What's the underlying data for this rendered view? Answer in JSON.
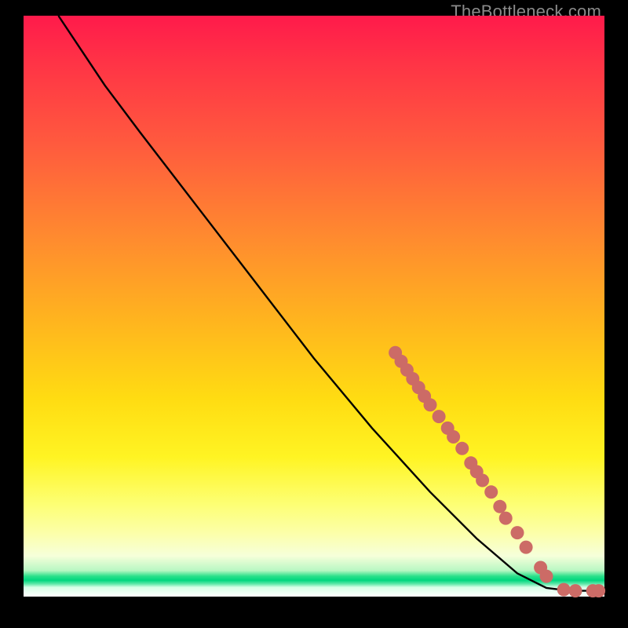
{
  "watermark": "TheBottleneck.com",
  "chart_data": {
    "type": "line",
    "title": "",
    "xlabel": "",
    "ylabel": "",
    "xlim": [
      0,
      100
    ],
    "ylim": [
      0,
      100
    ],
    "grid": false,
    "curve": {
      "name": "bottleneck-curve",
      "points": [
        {
          "x": 6,
          "y": 100
        },
        {
          "x": 10,
          "y": 94
        },
        {
          "x": 14,
          "y": 88
        },
        {
          "x": 20,
          "y": 80
        },
        {
          "x": 30,
          "y": 67
        },
        {
          "x": 40,
          "y": 54
        },
        {
          "x": 50,
          "y": 41
        },
        {
          "x": 60,
          "y": 29
        },
        {
          "x": 70,
          "y": 18
        },
        {
          "x": 78,
          "y": 10
        },
        {
          "x": 85,
          "y": 4
        },
        {
          "x": 90,
          "y": 1.5
        },
        {
          "x": 94,
          "y": 1
        },
        {
          "x": 100,
          "y": 1
        }
      ]
    },
    "markers": {
      "name": "data-markers",
      "color": "#cc6b66",
      "points": [
        {
          "x": 64,
          "y": 42
        },
        {
          "x": 65,
          "y": 40.5
        },
        {
          "x": 66,
          "y": 39
        },
        {
          "x": 67,
          "y": 37.5
        },
        {
          "x": 68,
          "y": 36
        },
        {
          "x": 69,
          "y": 34.5
        },
        {
          "x": 70,
          "y": 33
        },
        {
          "x": 71.5,
          "y": 31
        },
        {
          "x": 73,
          "y": 29
        },
        {
          "x": 74,
          "y": 27.5
        },
        {
          "x": 75.5,
          "y": 25.5
        },
        {
          "x": 77,
          "y": 23
        },
        {
          "x": 78,
          "y": 21.5
        },
        {
          "x": 79,
          "y": 20
        },
        {
          "x": 80.5,
          "y": 18
        },
        {
          "x": 82,
          "y": 15.5
        },
        {
          "x": 83,
          "y": 13.5
        },
        {
          "x": 85,
          "y": 11
        },
        {
          "x": 86.5,
          "y": 8.5
        },
        {
          "x": 89,
          "y": 5
        },
        {
          "x": 90,
          "y": 3.5
        },
        {
          "x": 93,
          "y": 1.2
        },
        {
          "x": 95,
          "y": 1
        },
        {
          "x": 98,
          "y": 1
        },
        {
          "x": 99,
          "y": 1
        }
      ]
    }
  }
}
